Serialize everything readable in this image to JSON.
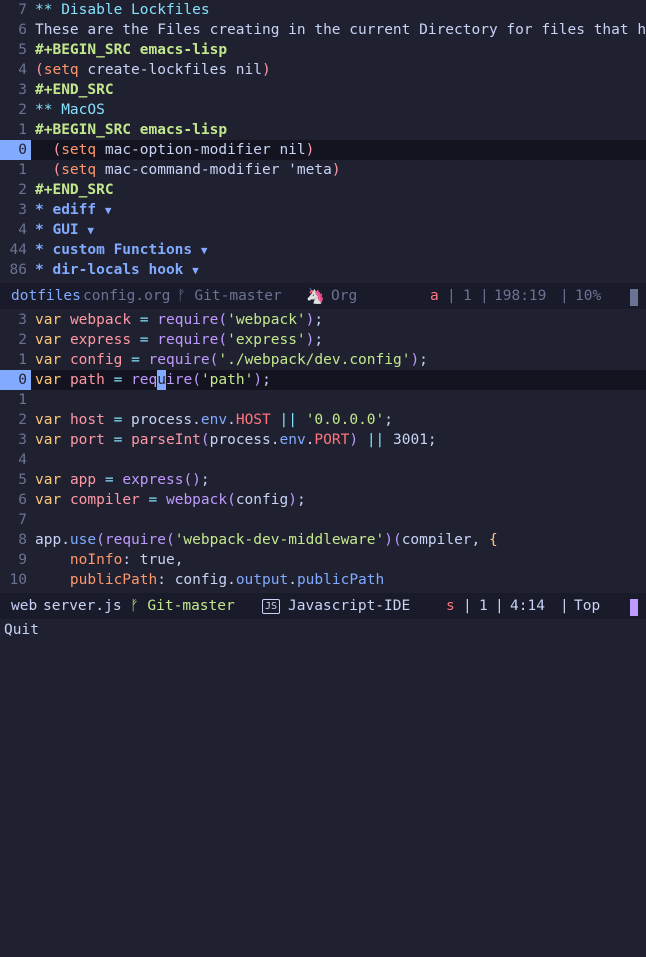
{
  "top_buffer": {
    "lines": [
      {
        "ln": "7",
        "parts": [
          [
            "org-h2",
            "** Disable Lockfiles"
          ]
        ]
      },
      {
        "ln": "6",
        "parts": [
          [
            "txt",
            "These are the Files creating in the current Directory for files that have no-"
          ]
        ]
      },
      {
        "ln": "5",
        "parts": [
          [
            "org-meta",
            "#+BEGIN_SRC emacs-lisp"
          ]
        ]
      },
      {
        "ln": "4",
        "parts": [
          [
            "paren",
            "("
          ],
          [
            "kw",
            "setq"
          ],
          [
            "txt",
            " create-lockfiles nil"
          ],
          [
            "paren",
            ")"
          ]
        ]
      },
      {
        "ln": "3",
        "parts": [
          [
            "org-meta",
            "#+END_SRC"
          ]
        ]
      },
      {
        "ln": "2",
        "parts": [
          [
            "org-h2",
            "** MacOS"
          ]
        ]
      },
      {
        "ln": "1",
        "parts": [
          [
            "org-meta",
            "#+BEGIN_SRC emacs-lisp"
          ]
        ]
      },
      {
        "ln": "0",
        "current": true,
        "parts": [
          [
            "txt",
            "  "
          ],
          [
            "paren",
            "("
          ],
          [
            "kw",
            "setq"
          ],
          [
            "txt",
            " mac-option-modifier nil"
          ],
          [
            "paren",
            ")"
          ]
        ]
      },
      {
        "ln": "1",
        "parts": [
          [
            "txt",
            "  "
          ],
          [
            "paren",
            "("
          ],
          [
            "kw",
            "setq"
          ],
          [
            "txt",
            " mac-command-modifier 'meta"
          ],
          [
            "paren",
            ")"
          ]
        ]
      },
      {
        "ln": "2",
        "parts": [
          [
            "org-meta",
            "#+END_SRC"
          ]
        ]
      },
      {
        "ln": "3",
        "parts": [
          [
            "org-h1",
            "* ediff "
          ],
          [
            "arrow",
            "▼"
          ]
        ]
      },
      {
        "ln": "4",
        "parts": [
          [
            "org-h1",
            "* GUI "
          ],
          [
            "arrow",
            "▼"
          ]
        ]
      },
      {
        "ln": "44",
        "parts": [
          [
            "org-h1",
            "* custom Functions "
          ],
          [
            "arrow",
            "▼"
          ]
        ]
      },
      {
        "ln": "86",
        "parts": [
          [
            "org-h1",
            "* dir-locals hook "
          ],
          [
            "arrow",
            "▼"
          ]
        ]
      }
    ]
  },
  "top_modeline": {
    "buffer": "dotfiles",
    "file": "config.org",
    "git": "ᚠ Git-master",
    "mode_icon": "unicorn-icon",
    "mode": "Org",
    "state": "a",
    "sep1": "|",
    "count": "1",
    "sep2": "|",
    "position": "198:19",
    "sep3": "|",
    "percent": "10%"
  },
  "bottom_buffer": {
    "lines": [
      {
        "ln": "3",
        "parts": [
          [
            "js-var",
            "var"
          ],
          [
            "txt",
            " "
          ],
          [
            "js-id",
            "webpack"
          ],
          [
            "txt",
            " "
          ],
          [
            "js-op",
            "="
          ],
          [
            "txt",
            " "
          ],
          [
            "js-fn",
            "require"
          ],
          [
            "js-br",
            "("
          ],
          [
            "js-str",
            "'webpack'"
          ],
          [
            "js-br",
            ")"
          ],
          [
            "txt",
            ";"
          ]
        ]
      },
      {
        "ln": "2",
        "parts": [
          [
            "js-var",
            "var"
          ],
          [
            "txt",
            " "
          ],
          [
            "js-id",
            "express"
          ],
          [
            "txt",
            " "
          ],
          [
            "js-op",
            "="
          ],
          [
            "txt",
            " "
          ],
          [
            "js-fn",
            "require"
          ],
          [
            "js-br",
            "("
          ],
          [
            "js-str",
            "'express'"
          ],
          [
            "js-br",
            ")"
          ],
          [
            "txt",
            ";"
          ]
        ]
      },
      {
        "ln": "1",
        "parts": [
          [
            "js-var",
            "var"
          ],
          [
            "txt",
            " "
          ],
          [
            "js-id",
            "config"
          ],
          [
            "txt",
            " "
          ],
          [
            "js-op",
            "="
          ],
          [
            "txt",
            " "
          ],
          [
            "js-fn",
            "require"
          ],
          [
            "js-br",
            "("
          ],
          [
            "js-str",
            "'./webpack/dev.config'"
          ],
          [
            "js-br",
            ")"
          ],
          [
            "txt",
            ";"
          ]
        ]
      },
      {
        "ln": "0",
        "current": true,
        "parts": [
          [
            "js-var",
            "var"
          ],
          [
            "txt",
            " "
          ],
          [
            "js-id",
            "path"
          ],
          [
            "txt",
            " "
          ],
          [
            "js-op",
            "="
          ],
          [
            "txt",
            " "
          ],
          [
            "js-fn",
            "req"
          ],
          [
            "cursor",
            "u"
          ],
          [
            "js-fn",
            "ire"
          ],
          [
            "js-br",
            "("
          ],
          [
            "js-str",
            "'path'"
          ],
          [
            "js-br",
            ")"
          ],
          [
            "txt",
            ";"
          ]
        ]
      },
      {
        "ln": "1",
        "parts": []
      },
      {
        "ln": "2",
        "parts": [
          [
            "js-var",
            "var"
          ],
          [
            "txt",
            " "
          ],
          [
            "js-id",
            "host"
          ],
          [
            "txt",
            " "
          ],
          [
            "js-op",
            "="
          ],
          [
            "txt",
            " process."
          ],
          [
            "js-prop",
            "env"
          ],
          [
            "txt",
            "."
          ],
          [
            "js-const",
            "HOST"
          ],
          [
            "txt",
            " "
          ],
          [
            "js-op",
            "||"
          ],
          [
            "txt",
            " "
          ],
          [
            "js-str",
            "'0.0.0.0'"
          ],
          [
            "txt",
            ";"
          ]
        ]
      },
      {
        "ln": "3",
        "parts": [
          [
            "js-var",
            "var"
          ],
          [
            "txt",
            " "
          ],
          [
            "js-id",
            "port"
          ],
          [
            "txt",
            " "
          ],
          [
            "js-op",
            "="
          ],
          [
            "txt",
            " "
          ],
          [
            "js-id",
            "parseInt"
          ],
          [
            "js-br",
            "("
          ],
          [
            "txt",
            "process."
          ],
          [
            "js-prop",
            "env"
          ],
          [
            "txt",
            "."
          ],
          [
            "js-const",
            "PORT"
          ],
          [
            "js-br",
            ")"
          ],
          [
            "txt",
            " "
          ],
          [
            "js-op",
            "||"
          ],
          [
            "txt",
            " 3001;"
          ]
        ]
      },
      {
        "ln": "4",
        "parts": []
      },
      {
        "ln": "5",
        "parts": [
          [
            "js-var",
            "var"
          ],
          [
            "txt",
            " "
          ],
          [
            "js-id",
            "app"
          ],
          [
            "txt",
            " "
          ],
          [
            "js-op",
            "="
          ],
          [
            "txt",
            " "
          ],
          [
            "js-fn",
            "express"
          ],
          [
            "js-br",
            "()"
          ],
          [
            "txt",
            ";"
          ]
        ]
      },
      {
        "ln": "6",
        "parts": [
          [
            "js-var",
            "var"
          ],
          [
            "txt",
            " "
          ],
          [
            "js-id",
            "compiler"
          ],
          [
            "txt",
            " "
          ],
          [
            "js-op",
            "="
          ],
          [
            "txt",
            " "
          ],
          [
            "js-fn",
            "webpack"
          ],
          [
            "js-br",
            "("
          ],
          [
            "txt",
            "config"
          ],
          [
            "js-br",
            ")"
          ],
          [
            "txt",
            ";"
          ]
        ]
      },
      {
        "ln": "7",
        "parts": []
      },
      {
        "ln": "8",
        "parts": [
          [
            "txt",
            "app."
          ],
          [
            "js-prop",
            "use"
          ],
          [
            "js-br",
            "("
          ],
          [
            "js-fn",
            "require"
          ],
          [
            "js-br",
            "("
          ],
          [
            "js-str",
            "'webpack-dev-middleware'"
          ],
          [
            "js-br",
            ")("
          ],
          [
            "txt",
            "compiler, "
          ],
          [
            "js-var",
            "{"
          ]
        ]
      },
      {
        "ln": "9",
        "parts": [
          [
            "txt",
            "    "
          ],
          [
            "js-key",
            "noInfo"
          ],
          [
            "txt",
            ": true,"
          ]
        ]
      },
      {
        "ln": "10",
        "parts": [
          [
            "txt",
            "    "
          ],
          [
            "js-key",
            "publicPath"
          ],
          [
            "txt",
            ": config."
          ],
          [
            "js-prop",
            "output"
          ],
          [
            "txt",
            "."
          ],
          [
            "js-prop",
            "publicPath"
          ]
        ]
      }
    ]
  },
  "bottom_modeline": {
    "buffer": "web",
    "file": "server.js",
    "git": "ᚠ Git-master",
    "mode_badge": "JS",
    "mode": "Javascript-IDE",
    "state": "s",
    "sep1": "|",
    "count": "1",
    "sep2": "|",
    "position": "4:14",
    "sep3": "|",
    "percent": "Top"
  },
  "minibuffer": {
    "message": "Quit"
  },
  "colors": {
    "background": "#1f2130",
    "modeline": "#191a2a",
    "current_line_number": "#82aaff",
    "accent_purple": "#c099ff"
  }
}
